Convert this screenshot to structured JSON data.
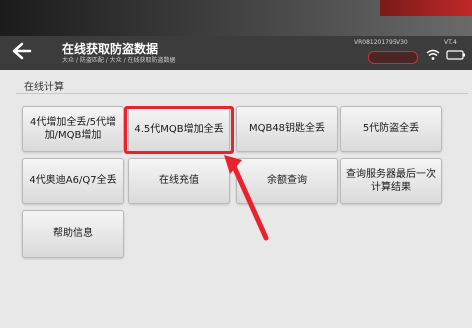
{
  "header": {
    "title": "在线获取防盗数据",
    "breadcrumb": "大众 / 防盗匹配 / 大众 / 在线获取防盗数据",
    "vin": "VR081201795",
    "version": "V30",
    "vt": "VT.4"
  },
  "section": {
    "label": "在线计算"
  },
  "buttons": [
    {
      "label": "4代增加全丢/5代增加/MQB增加"
    },
    {
      "label": "4.5代MQB增加全丢"
    },
    {
      "label": "MQB48钥匙全丢"
    },
    {
      "label": "5代防盗全丢"
    },
    {
      "label": "4代奥迪A6/Q7全丢"
    },
    {
      "label": "在线充值"
    },
    {
      "label": "余额查询"
    },
    {
      "label": "查询服务器最后一次计算结果"
    },
    {
      "label": "帮助信息"
    }
  ],
  "highlight": {
    "color": "#e8222e",
    "target": "4.5代MQB增加全丢"
  },
  "icons": [
    "back-arrow-icon",
    "wifi-icon",
    "vci-icon"
  ]
}
